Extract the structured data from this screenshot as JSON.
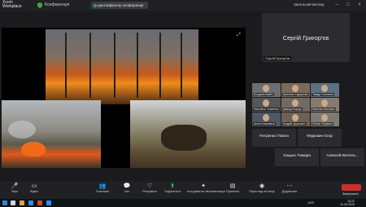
{
  "window": {
    "logo": "Zoom\nWorkplace",
    "meeting_title": "Конференція",
    "url_text": "Ідентифікатор конференції",
    "top_right": "Загальний вигляд"
  },
  "speaker": {
    "name": "Сергій Григор'єв",
    "tag": "Сергій Григор'єв"
  },
  "participants": [
    {
      "label": "Богдана Бабіч"
    },
    {
      "label": "Крістіна Сідоренко"
    },
    {
      "label": "Тимур Гостенко"
    },
    {
      "label": "Михайло Ткаченко"
    },
    {
      "label": "Давид Бороді"
    },
    {
      "label": "Євгенія Шостако"
    },
    {
      "label": "Анна Кожемяка"
    },
    {
      "label": "Андрій Дорошен"
    },
    {
      "label": "Лесия Ягужинс"
    }
  ],
  "name_tiles": [
    {
      "name": "Петренко Павло",
      "tag": "Петренко Павло"
    },
    {
      "name": "Федюкин Єгор",
      "tag": "Федюкин Єгор"
    },
    {
      "name": "Хацько Тамара",
      "tag": "Хацько Тамара"
    },
    {
      "name": "Алексей Весель...",
      "tag": "Алексей Весель..."
    }
  ],
  "toolbar": {
    "audio": "Звук",
    "video": "Відео",
    "participants": "Учасники",
    "participants_count": "55",
    "chat": "Чат",
    "react": "Реагувати",
    "share": "Поділитися",
    "ai_companion": "Інструменти автоматизації",
    "notes": "Примітки",
    "recording": "Перегляд на місці",
    "more": "Додатково",
    "end": "Завершити"
  },
  "taskbar": {
    "lang": "UKR",
    "time": "16:22",
    "date": "19.06.2025"
  }
}
